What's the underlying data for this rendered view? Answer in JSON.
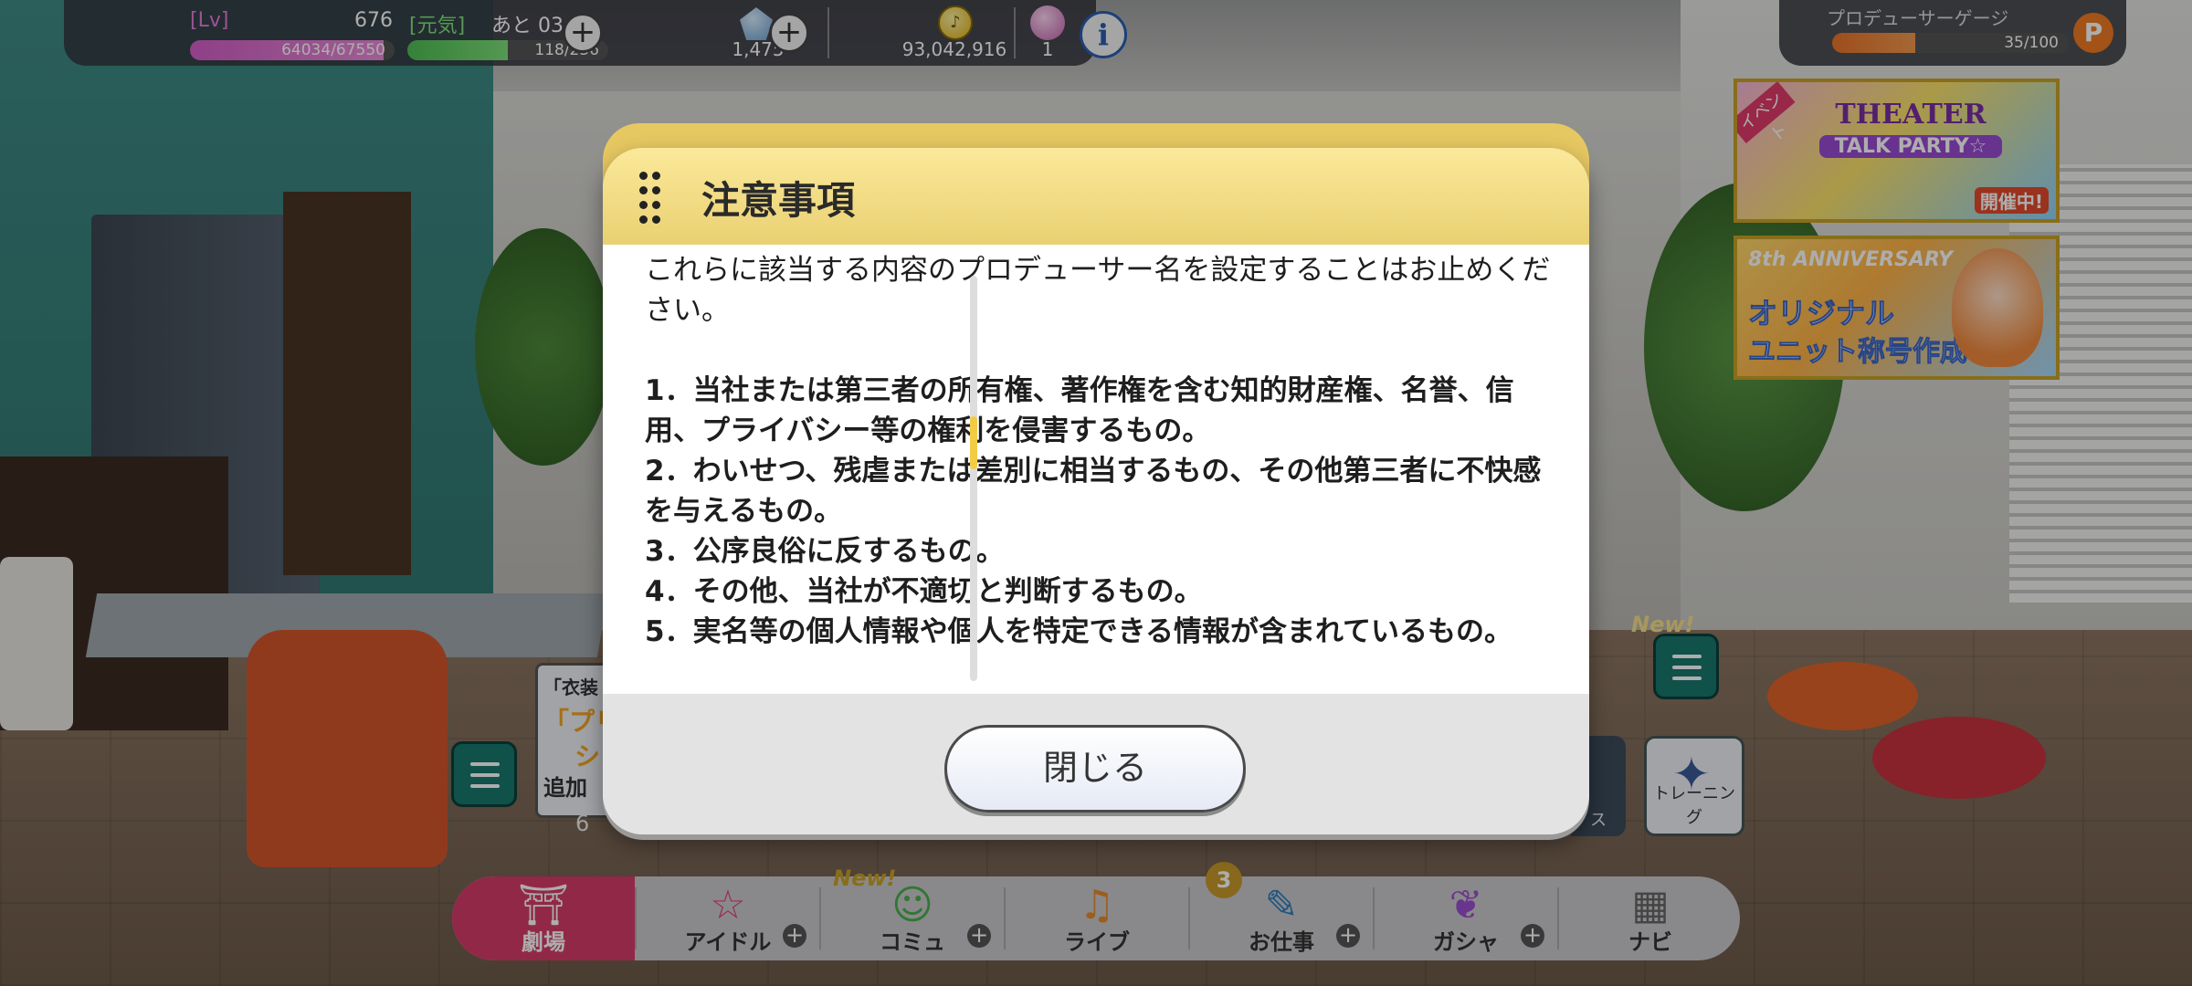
{
  "status": {
    "lv_label": "[Lv]",
    "lv_value": "676",
    "genki_label": "[元気]",
    "remaining_label": "あと 03:31",
    "exp_text": "64034/67550",
    "exp_fraction": 0.948,
    "stamina_text": "118/236",
    "stamina_fraction": 0.5,
    "gems": "1,475",
    "money": "93,042,916",
    "tickets": "1",
    "accent_colors": {
      "lv": "#e87bdc",
      "genki": "#7fe07a",
      "dialog_header": "#fbe99a",
      "active_tab": "#d83c6a"
    }
  },
  "gauge": {
    "label": "プロデューサーゲージ",
    "value_text": "35/100",
    "fraction": 0.35,
    "icon": "P"
  },
  "banners": {
    "event_tag": "イベント",
    "event_title": "THEATER",
    "event_subtitle": "TALK PARTY☆",
    "event_status": "開催中!",
    "anniversary_tag": "8th ANNIVERSARY",
    "anniversary_line1": "オリジナル",
    "anniversary_line2": "ユニット称号作成!"
  },
  "side": {
    "new_label": "New!",
    "training_label": "トレーニング",
    "partial_label": "ス",
    "notice_l1": "「衣装",
    "notice_l2": "「プリ",
    "notice_l2b": "シ",
    "notice_l3": "追加",
    "notice_count": "6"
  },
  "dialog": {
    "title": "注意事項",
    "intro": "これらに該当する内容のプロデューサー名を設定することはお止めください。",
    "items": [
      "1．当社または第三者の所有権、著作権を含む知的財産権、名誉、信用、プライバシー等の権利を侵害するもの。",
      "2．わいせつ、残虐または差別に相当するもの、その他第三者に不快感を与えるもの。",
      "3．公序良俗に反するもの。",
      "4．その他、当社が不適切と判断するもの。",
      "5．実名等の個人情報や個人を特定できる情報が含まれているもの。"
    ],
    "close_label": "閉じる",
    "scroll_position": 0.4
  },
  "nav": {
    "items": [
      {
        "label": "劇場",
        "icon": "theater-icon"
      },
      {
        "label": "アイドル",
        "icon": "idol-icon"
      },
      {
        "label": "コミュ",
        "icon": "commu-icon"
      },
      {
        "label": "ライブ",
        "icon": "live-icon"
      },
      {
        "label": "お仕事",
        "icon": "work-icon"
      },
      {
        "label": "ガシャ",
        "icon": "gacha-icon"
      },
      {
        "label": "ナビ",
        "icon": "navi-icon"
      }
    ],
    "commu_new": "New!",
    "work_badge": "3"
  }
}
